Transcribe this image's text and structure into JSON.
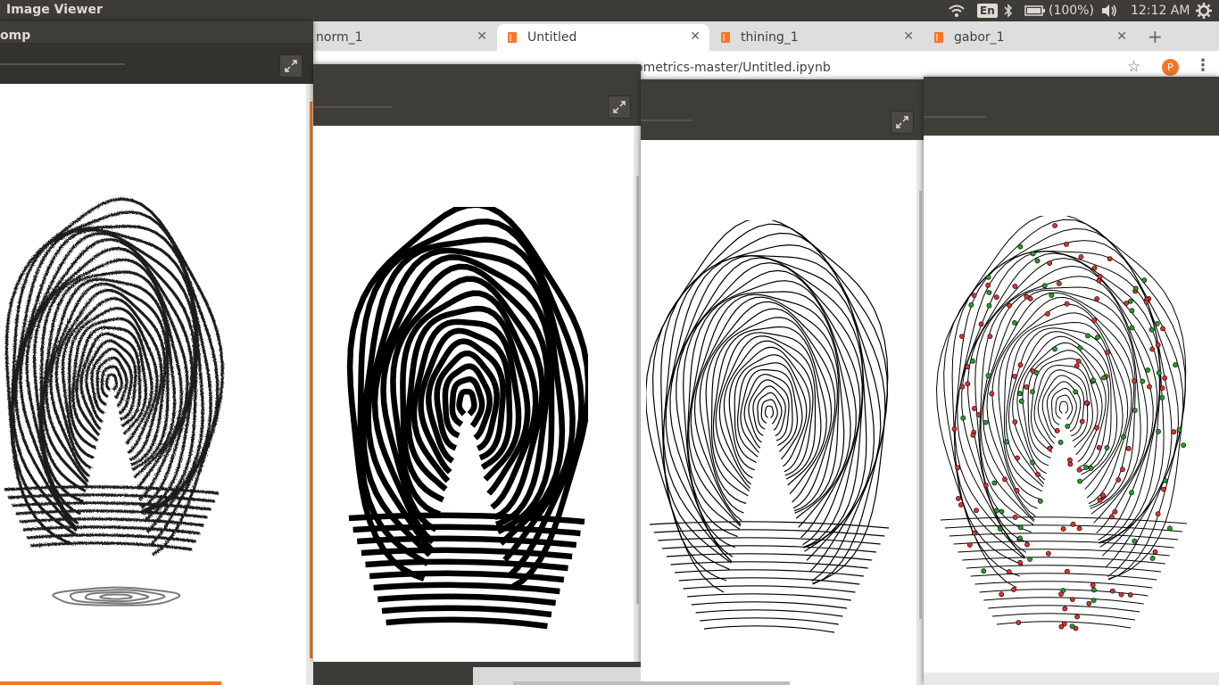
{
  "top_panel": {
    "app_title": "Image Viewer",
    "keyboard_layout": "En",
    "battery": "(100%)",
    "clock": "12:12 AM"
  },
  "browser": {
    "tabs": [
      {
        "label": "norm_1",
        "active": false
      },
      {
        "label": "Untitled",
        "active": true
      },
      {
        "label": "thining_1",
        "active": false
      },
      {
        "label": "gabor_1",
        "active": false
      }
    ],
    "url_fragment": "ometrics-master/Untitled.ipynb",
    "profile_initial": "P",
    "accent_color": "#f37626"
  },
  "windows": {
    "original": {
      "title_fragment": "omp"
    }
  },
  "colors": {
    "panel_bg": "#3d3c38",
    "tab_strip": "#dedede",
    "orange": "#f37626",
    "minutia_ending": "#e03030",
    "minutia_bifurcation": "#2a9a2a"
  }
}
